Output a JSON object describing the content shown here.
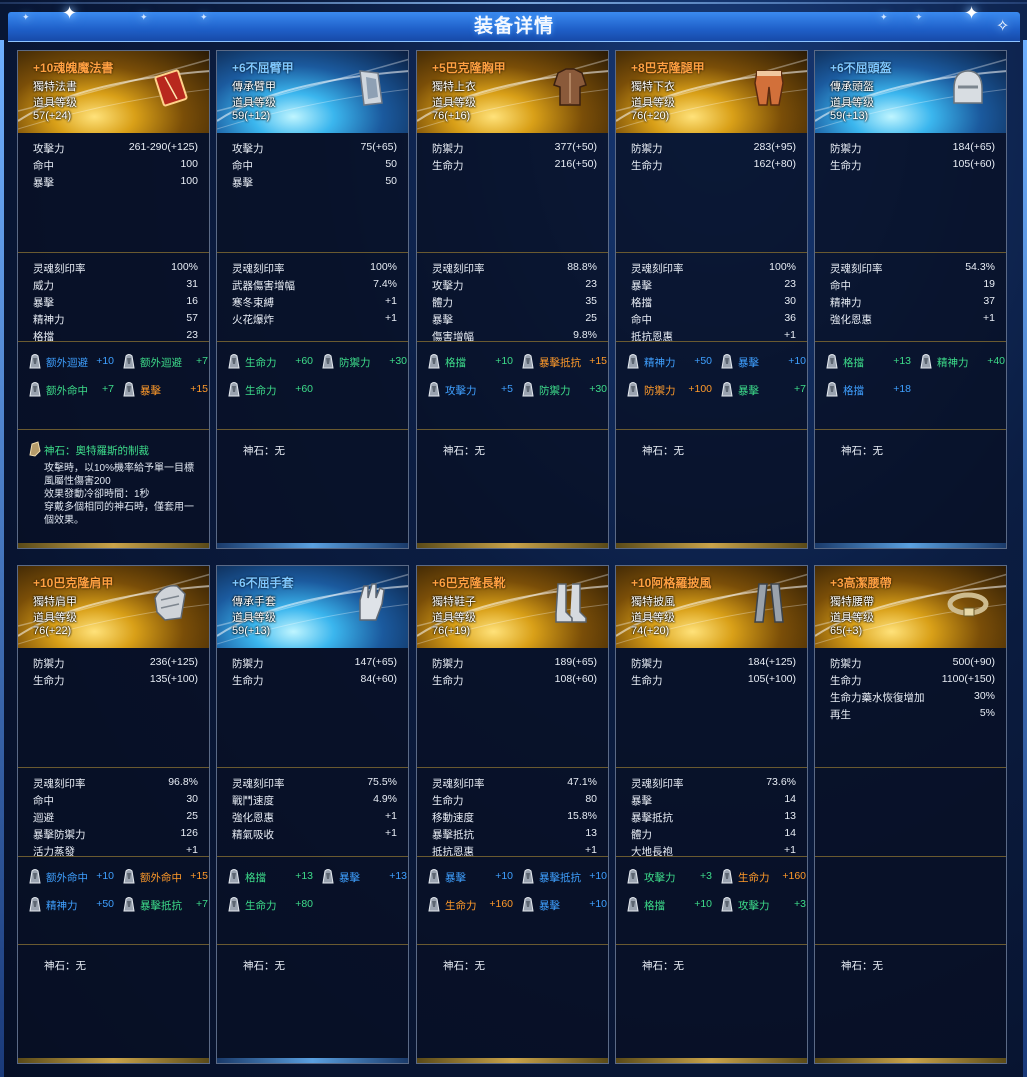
{
  "title": "装备详情",
  "stone_label": "神石：",
  "stone_none": "无",
  "colors": {
    "accent": "#2f7ae8",
    "gold": "#ffa040",
    "blue": "#7fc8ff",
    "gem_blue": "#3fa0ff",
    "gem_green": "#3ddc8a",
    "gem_orange": "#ff9a2a"
  },
  "items": [
    {
      "name": "+10魂魄魔法書",
      "tier": "gold",
      "type": "獨特法書",
      "lv_label": "道具等级",
      "lv": "57(+24)",
      "icon": "spellbook-icon",
      "base": [
        [
          "攻擊力",
          "261-290(+125)"
        ],
        [
          "命中",
          "100"
        ],
        [
          "暴擊",
          "100"
        ]
      ],
      "adv": [
        [
          "灵魂刻印率",
          "100%"
        ],
        [
          "威力",
          "31"
        ],
        [
          "暴擊",
          "16"
        ],
        [
          "精神力",
          "57"
        ],
        [
          "格擋",
          "23"
        ]
      ],
      "gems": [
        [
          "额外迴避",
          "+10",
          "blue"
        ],
        [
          "额外迴避",
          "+7",
          "green"
        ],
        [
          "额外命中",
          "+7",
          "green"
        ],
        [
          "暴擊",
          "+15",
          "orange"
        ]
      ],
      "stone": "神石：奧特羅斯的制裁",
      "stone_desc": "攻擊時，以10%機率給予單一目標\n風屬性傷害200\n效果發動冷卻時間：1秒\n穿戴多個相同的神石時，僅套用一\n個效果。"
    },
    {
      "name": "+6不屈臂甲",
      "tier": "blue",
      "type": "傳承臂甲",
      "lv_label": "道具等级",
      "lv": "59(+12)",
      "icon": "bracer-icon",
      "base": [
        [
          "攻擊力",
          "75(+65)"
        ],
        [
          "命中",
          "50"
        ],
        [
          "暴擊",
          "50"
        ]
      ],
      "adv": [
        [
          "灵魂刻印率",
          "100%"
        ],
        [
          "武器傷害增幅",
          "7.4%"
        ],
        [
          "寒冬束縛",
          "+1"
        ],
        [
          "火花爆炸",
          "+1"
        ]
      ],
      "gems": [
        [
          "生命力",
          "+60",
          "green"
        ],
        [
          "防禦力",
          "+30",
          "green"
        ],
        [
          "生命力",
          "+60",
          "green"
        ]
      ],
      "stone": "",
      "stone_desc": ""
    },
    {
      "name": "+5巴克隆胸甲",
      "tier": "gold",
      "type": "獨特上衣",
      "lv_label": "道具等级",
      "lv": "76(+16)",
      "icon": "chest-armor-icon",
      "base": [
        [
          "防禦力",
          "377(+50)"
        ],
        [
          "生命力",
          "216(+50)"
        ]
      ],
      "adv": [
        [
          "灵魂刻印率",
          "88.8%"
        ],
        [
          "攻擊力",
          "23"
        ],
        [
          "體力",
          "35"
        ],
        [
          "暴擊",
          "25"
        ],
        [
          "傷害增幅",
          "9.8%"
        ]
      ],
      "gems": [
        [
          "格擋",
          "+10",
          "green"
        ],
        [
          "暴擊抵抗",
          "+15",
          "orange"
        ],
        [
          "攻擊力",
          "+5",
          "blue"
        ],
        [
          "防禦力",
          "+30",
          "green"
        ]
      ],
      "stone": "",
      "stone_desc": ""
    },
    {
      "name": "+8巴克隆腿甲",
      "tier": "gold",
      "type": "獨特下衣",
      "lv_label": "道具等级",
      "lv": "76(+20)",
      "icon": "leg-armor-icon",
      "base": [
        [
          "防禦力",
          "283(+95)"
        ],
        [
          "生命力",
          "162(+80)"
        ]
      ],
      "adv": [
        [
          "灵魂刻印率",
          "100%"
        ],
        [
          "暴擊",
          "23"
        ],
        [
          "格擋",
          "30"
        ],
        [
          "命中",
          "36"
        ],
        [
          "抵抗恩惠",
          "+1"
        ]
      ],
      "gems": [
        [
          "精神力",
          "+50",
          "blue"
        ],
        [
          "暴擊",
          "+10",
          "blue"
        ],
        [
          "防禦力",
          "+100",
          "orange"
        ],
        [
          "暴擊",
          "+7",
          "green"
        ]
      ],
      "stone": "",
      "stone_desc": ""
    },
    {
      "name": "+6不屈頭盔",
      "tier": "blue",
      "type": "傳承頭盔",
      "lv_label": "道具等级",
      "lv": "59(+13)",
      "icon": "helmet-icon",
      "base": [
        [
          "防禦力",
          "184(+65)"
        ],
        [
          "生命力",
          "105(+60)"
        ]
      ],
      "adv": [
        [
          "灵魂刻印率",
          "54.3%"
        ],
        [
          "命中",
          "19"
        ],
        [
          "精神力",
          "37"
        ],
        [
          "強化恩惠",
          "+1"
        ]
      ],
      "gems": [
        [
          "格擋",
          "+13",
          "green"
        ],
        [
          "精神力",
          "+40",
          "green"
        ],
        [
          "格擋",
          "+18",
          "blue"
        ]
      ],
      "stone": "",
      "stone_desc": ""
    },
    {
      "name": "+10巴克隆肩甲",
      "tier": "gold",
      "type": "獨特肩甲",
      "lv_label": "道具等级",
      "lv": "76(+22)",
      "icon": "shoulder-armor-icon",
      "base": [
        [
          "防禦力",
          "236(+125)"
        ],
        [
          "生命力",
          "135(+100)"
        ]
      ],
      "adv": [
        [
          "灵魂刻印率",
          "96.8%"
        ],
        [
          "命中",
          "30"
        ],
        [
          "迴避",
          "25"
        ],
        [
          "暴擊防禦力",
          "126"
        ],
        [
          "活力蒸發",
          "+1"
        ]
      ],
      "gems": [
        [
          "额外命中",
          "+10",
          "blue"
        ],
        [
          "额外命中",
          "+15",
          "orange"
        ],
        [
          "精神力",
          "+50",
          "blue"
        ],
        [
          "暴擊抵抗",
          "+7",
          "green"
        ]
      ],
      "stone": "",
      "stone_desc": ""
    },
    {
      "name": "+6不屈手套",
      "tier": "blue",
      "type": "傳承手套",
      "lv_label": "道具等级",
      "lv": "59(+13)",
      "icon": "glove-icon",
      "base": [
        [
          "防禦力",
          "147(+65)"
        ],
        [
          "生命力",
          "84(+60)"
        ]
      ],
      "adv": [
        [
          "灵魂刻印率",
          "75.5%"
        ],
        [
          "戰鬥速度",
          "4.9%"
        ],
        [
          "強化恩惠",
          "+1"
        ],
        [
          "精氣吸收",
          "+1"
        ]
      ],
      "gems": [
        [
          "格擋",
          "+13",
          "green"
        ],
        [
          "暴擊",
          "+13",
          "blue"
        ],
        [
          "生命力",
          "+80",
          "green"
        ]
      ],
      "stone": "",
      "stone_desc": ""
    },
    {
      "name": "+6巴克隆長靴",
      "tier": "gold",
      "type": "獨特鞋子",
      "lv_label": "道具等级",
      "lv": "76(+19)",
      "icon": "boots-icon",
      "base": [
        [
          "防禦力",
          "189(+65)"
        ],
        [
          "生命力",
          "108(+60)"
        ]
      ],
      "adv": [
        [
          "灵魂刻印率",
          "47.1%"
        ],
        [
          "生命力",
          "80"
        ],
        [
          "移動速度",
          "15.8%"
        ],
        [
          "暴擊抵抗",
          "13"
        ],
        [
          "抵抗恩惠",
          "+1"
        ]
      ],
      "gems": [
        [
          "暴擊",
          "+10",
          "blue"
        ],
        [
          "暴擊抵抗",
          "+10",
          "blue"
        ],
        [
          "生命力",
          "+160",
          "orange"
        ],
        [
          "暴擊",
          "+10",
          "blue"
        ]
      ],
      "stone": "",
      "stone_desc": ""
    },
    {
      "name": "+10阿格羅披風",
      "tier": "gold",
      "type": "獨特披風",
      "lv_label": "道具等级",
      "lv": "74(+20)",
      "icon": "cape-icon",
      "base": [
        [
          "防禦力",
          "184(+125)"
        ],
        [
          "生命力",
          "105(+100)"
        ]
      ],
      "adv": [
        [
          "灵魂刻印率",
          "73.6%"
        ],
        [
          "暴擊",
          "14"
        ],
        [
          "暴擊抵抗",
          "13"
        ],
        [
          "體力",
          "14"
        ],
        [
          "大地長袍",
          "+1"
        ]
      ],
      "gems": [
        [
          "攻擊力",
          "+3",
          "green"
        ],
        [
          "生命力",
          "+160",
          "orange"
        ],
        [
          "格擋",
          "+10",
          "green"
        ],
        [
          "攻擊力",
          "+3",
          "green"
        ]
      ],
      "stone": "",
      "stone_desc": ""
    },
    {
      "name": "+3高潔腰帶",
      "tier": "gold",
      "type": "獨特腰帶",
      "lv_label": "道具等级",
      "lv": "65(+3)",
      "icon": "belt-icon",
      "base": [
        [
          "防禦力",
          "500(+90)"
        ],
        [
          "生命力",
          "1100(+150)"
        ],
        [
          "生命力藥水恢復增加",
          "30%"
        ],
        [
          "再生",
          "5%"
        ]
      ],
      "adv": [],
      "gems": [],
      "stone": "",
      "stone_desc": ""
    }
  ]
}
